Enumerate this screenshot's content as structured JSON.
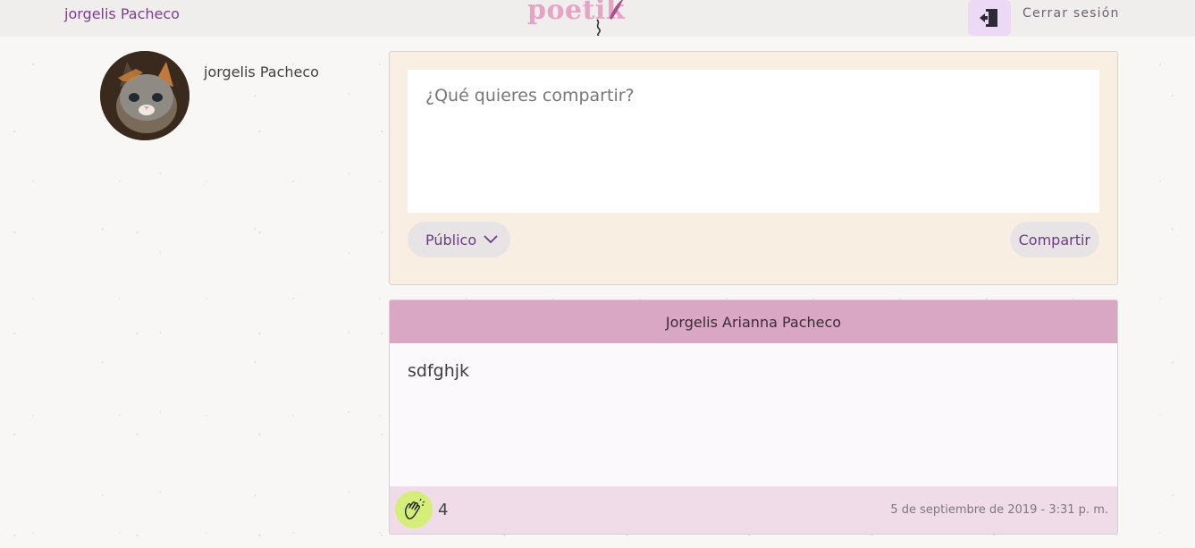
{
  "header": {
    "user_name": "jorgelis Pacheco",
    "logo_text": "poetik",
    "logout_label": "Cerrar sesión"
  },
  "profile": {
    "name": "jorgelis Pacheco"
  },
  "compose": {
    "placeholder": "¿Qué quieres compartir?",
    "privacy_label": "Público",
    "share_label": "Compartir"
  },
  "post": {
    "author": "Jorgelis Arianna Pacheco",
    "content": "sdfghjk",
    "claps": "4",
    "date": "5 de septiembre de 2019 - 3:31 p. m."
  },
  "colors": {
    "brand": "#e6a3c4",
    "accent_purple": "#7b3f8c",
    "post_header": "#d9a6c3",
    "clap_green": "#d5ee7a"
  },
  "icons": {
    "logout": "logout-door-icon",
    "privacy_dropdown": "chevron-down-icon",
    "clap": "clapping-hands-icon",
    "logo_feather": "feather-icon"
  }
}
